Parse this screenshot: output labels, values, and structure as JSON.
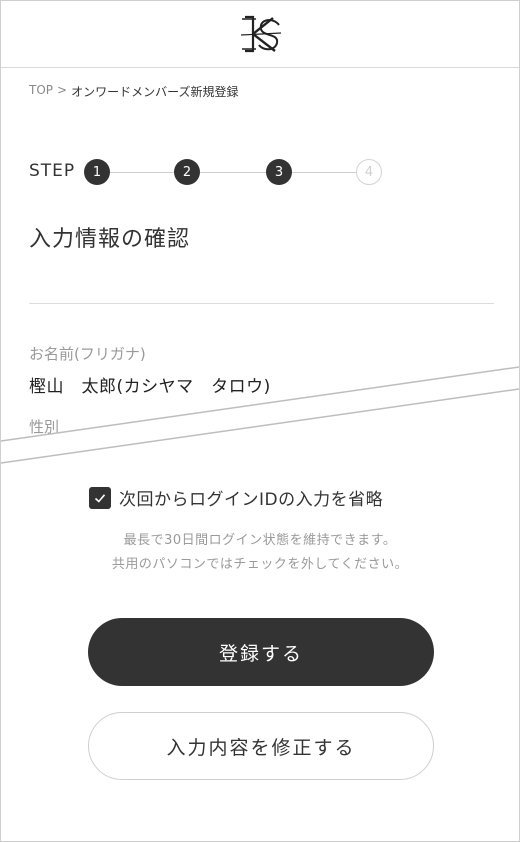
{
  "breadcrumb": {
    "home": "TOP",
    "separator": ">",
    "current": "オンワードメンバーズ新規登録"
  },
  "stepper": {
    "label": "STEP",
    "steps": [
      "1",
      "2",
      "3",
      "4"
    ],
    "current": 3
  },
  "page_title": "入力情報の確認",
  "fields": {
    "name_label": "お名前(フリガナ)",
    "name_value": "樫山　太郎(カシヤマ　タロウ)",
    "gender_label": "性別"
  },
  "remember": {
    "label": "次回からログインIDの入力を省略",
    "checked": true,
    "note_line1": "最長で30日間ログイン状態を維持できます。",
    "note_line2": "共用のパソコンではチェックを外してください。"
  },
  "buttons": {
    "register": "登録する",
    "edit": "入力内容を修正する"
  },
  "colors": {
    "primary": "#333333",
    "muted": "#9a9a9a",
    "border": "#cfcfcf"
  }
}
